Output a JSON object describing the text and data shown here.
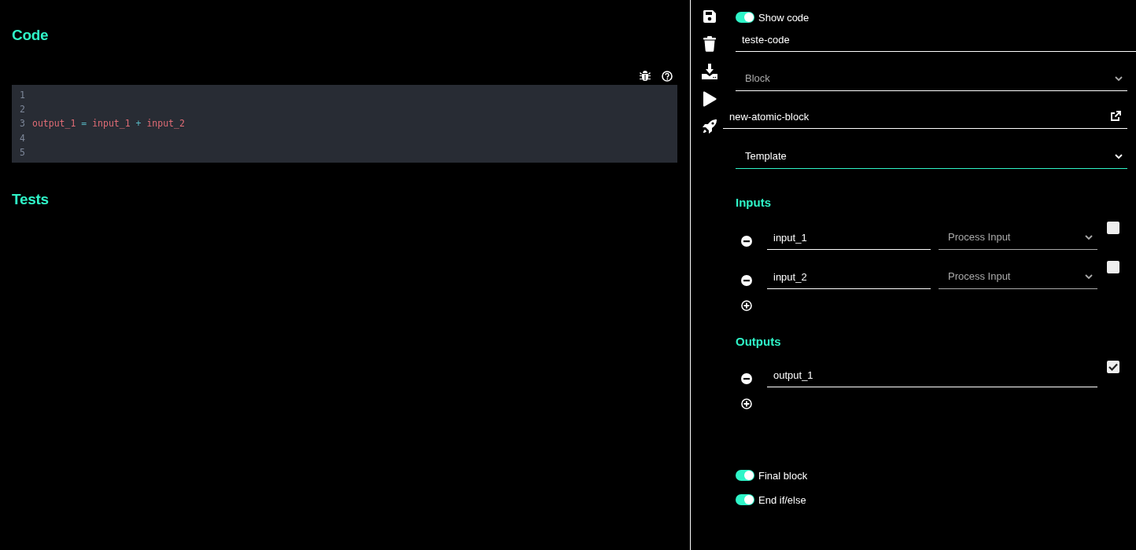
{
  "code_panel": {
    "title": "Code",
    "toolbar": [
      {
        "kind": "bug"
      },
      {
        "kind": "help"
      }
    ],
    "lines": [
      {
        "number": "1"
      },
      {
        "number": "2"
      },
      {
        "number": "3",
        "tokens": [
          {
            "text": "output_1",
            "kind": "name"
          },
          {
            "text": " = ",
            "kind": "operator"
          },
          {
            "text": "input_1",
            "kind": "name"
          },
          {
            "text": " + ",
            "kind": "operator"
          },
          {
            "text": "input_2",
            "kind": "name"
          }
        ]
      },
      {
        "number": "4"
      },
      {
        "number": "5"
      }
    ],
    "tests_title": "Tests"
  },
  "sidebar": {
    "actions": [
      {
        "kind": "save"
      },
      {
        "kind": "delete"
      },
      {
        "kind": "download"
      },
      {
        "kind": "run"
      },
      {
        "kind": "deploy"
      }
    ],
    "show_code": {
      "label": "Show code",
      "on": true
    },
    "name_field": {
      "value": "teste-code"
    },
    "block_select": {
      "placeholder": "Block",
      "focused": false
    },
    "block_name": {
      "value": "new-atomic-block"
    },
    "template_select": {
      "value": "Template",
      "focused": true
    },
    "inputs": {
      "title": "Inputs",
      "items": [
        {
          "name": "input_1",
          "type_placeholder": "Process Input",
          "checked": false
        },
        {
          "name": "input_2",
          "type_placeholder": "Process Input",
          "checked": false
        }
      ]
    },
    "outputs": {
      "title": "Outputs",
      "items": [
        {
          "name": "output_1",
          "checked": true
        }
      ]
    },
    "final_block": {
      "label": "Final block",
      "on": true
    },
    "end_if_else": {
      "label": "End if/else",
      "on": true
    }
  }
}
